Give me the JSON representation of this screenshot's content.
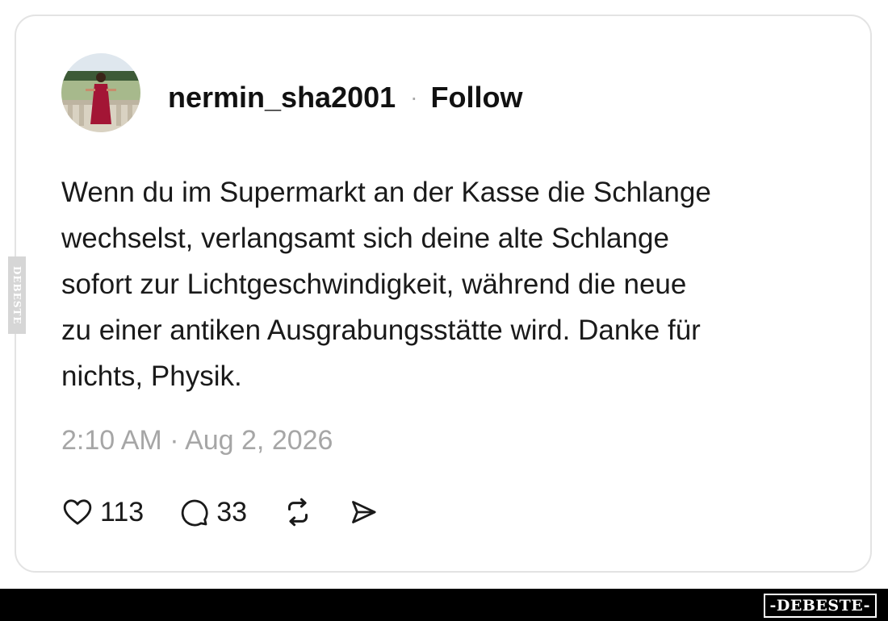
{
  "post": {
    "username": "nermin_sha2001",
    "separator": "·",
    "follow_label": "Follow",
    "text_lines": [
      "Wenn du im Supermarkt an der Kasse die Schlange",
      "wechselst, verlangsamt sich deine alte Schlange",
      "sofort zur Lichtgeschwindigkeit, während die neue",
      "zu einer antiken Ausgrabungsstätte wird. Danke für",
      "nichts, Physik."
    ],
    "timestamp": "2:10 AM · Aug 2, 2026",
    "likes": "113",
    "replies": "33"
  },
  "icons": {
    "avatar": "profile-photo",
    "like": "heart-icon",
    "reply": "speech-bubble-icon",
    "repost": "repost-arrows-icon",
    "share": "send-icon"
  },
  "watermark": {
    "footer_logo": "-DEBESTE-",
    "side_logo": "DEBESTE"
  },
  "colors": {
    "text": "#1a1a1a",
    "muted": "#a6a6a6",
    "card_border": "#e3e3e3",
    "footer_bg": "#000000"
  }
}
